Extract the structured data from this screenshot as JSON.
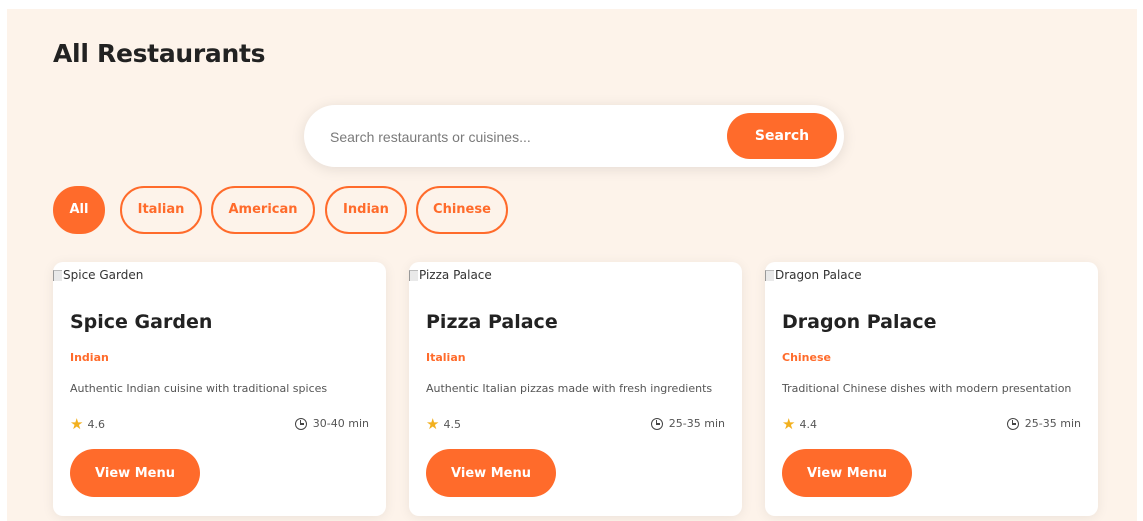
{
  "header": {
    "title": "All Restaurants"
  },
  "search": {
    "placeholder": "Search restaurants or cuisines...",
    "value": "",
    "button_label": "Search"
  },
  "filters": {
    "selected": "All",
    "items": [
      {
        "label": "All"
      },
      {
        "label": "Italian"
      },
      {
        "label": "American"
      },
      {
        "label": "Indian"
      },
      {
        "label": "Chinese"
      }
    ]
  },
  "restaurants": [
    {
      "image_alt": "Spice Garden",
      "name": "Spice Garden",
      "cuisine": "Indian",
      "description": "Authentic Indian cuisine with traditional spices",
      "rating": "4.6",
      "delivery_time": "30-40 min",
      "button_label": "View Menu"
    },
    {
      "image_alt": "Pizza Palace",
      "name": "Pizza Palace",
      "cuisine": "Italian",
      "description": "Authentic Italian pizzas made with fresh ingredients",
      "rating": "4.5",
      "delivery_time": "25-35 min",
      "button_label": "View Menu"
    },
    {
      "image_alt": "Dragon Palace",
      "name": "Dragon Palace",
      "cuisine": "Chinese",
      "description": "Traditional Chinese dishes with modern presentation",
      "rating": "4.4",
      "delivery_time": "25-35 min",
      "button_label": "View Menu"
    }
  ],
  "icons": {
    "rating": "star-icon",
    "time": "clock-icon",
    "image": "broken-image-icon"
  },
  "colors": {
    "accent": "#ff6b2b",
    "background": "#fdf3ea",
    "card": "#ffffff",
    "star": "#f2b01e"
  }
}
